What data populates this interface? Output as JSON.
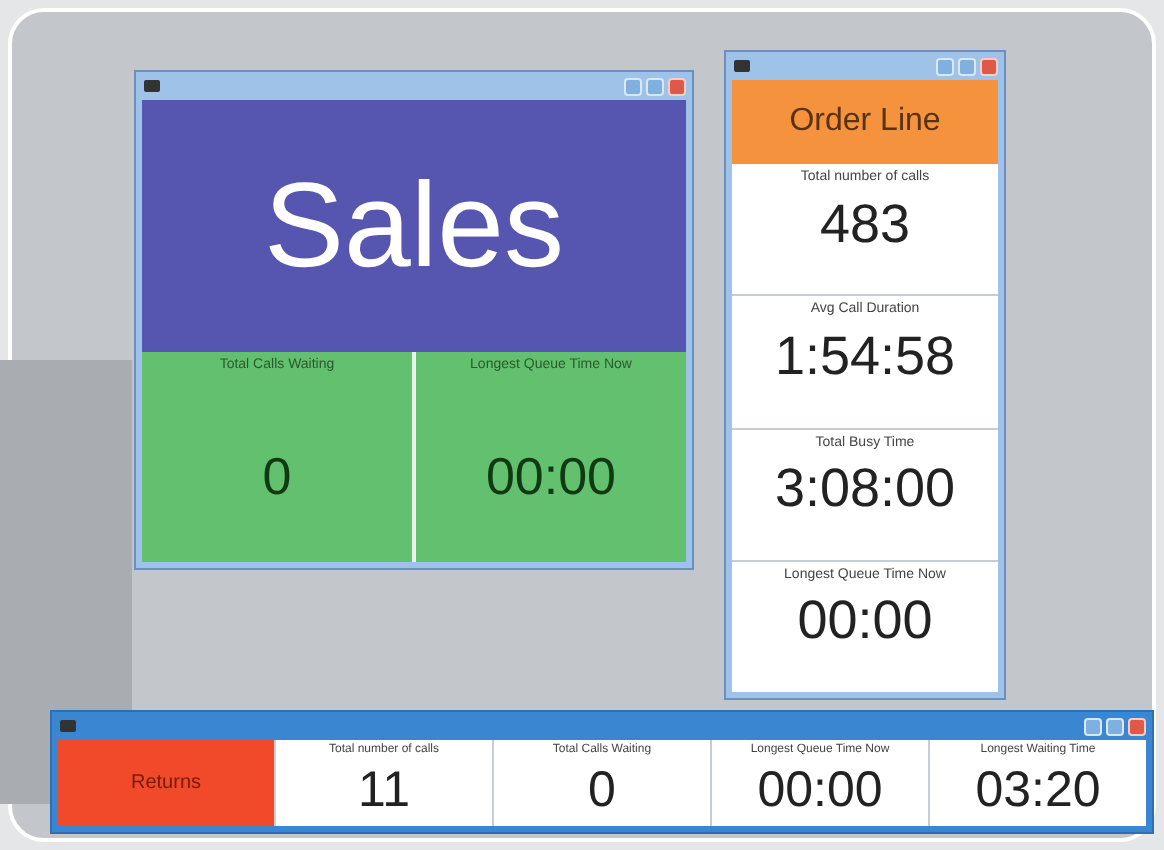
{
  "sales_window": {
    "heading": "Sales",
    "color": "#5656b0",
    "stats": [
      {
        "label": "Total Calls Waiting",
        "value": "0"
      },
      {
        "label": "Longest Queue Time Now",
        "value": "00:00"
      }
    ]
  },
  "order_line_window": {
    "heading": "Order Line",
    "color": "#f5923e",
    "stats": [
      {
        "label": "Total number of calls",
        "value": "483"
      },
      {
        "label": "Avg Call Duration",
        "value": "1:54:58"
      },
      {
        "label": "Total Busy Time",
        "value": "3:08:00"
      },
      {
        "label": "Longest Queue Time Now",
        "value": "00:00"
      }
    ]
  },
  "returns_window": {
    "heading": "Returns",
    "color": "#f04a2a",
    "stats": [
      {
        "label": "Total number of calls",
        "value": "11"
      },
      {
        "label": "Total Calls Waiting",
        "value": "0"
      },
      {
        "label": "Longest Queue Time Now",
        "value": "00:00"
      },
      {
        "label": "Longest Waiting Time",
        "value": "03:20"
      }
    ]
  }
}
